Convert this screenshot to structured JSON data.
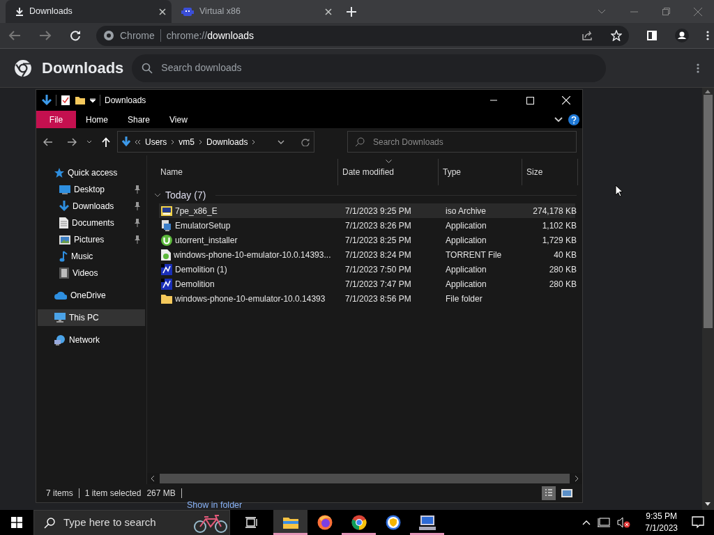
{
  "browser": {
    "tabs": [
      {
        "title": "Downloads",
        "kind": "downloads",
        "selected": true
      },
      {
        "title": "Virtual x86",
        "kind": "app",
        "selected": false
      }
    ],
    "address": {
      "origin_label": "Chrome",
      "url_prefix": "chrome://",
      "url_path": "downloads"
    }
  },
  "downloads_page": {
    "title": "Downloads",
    "search": {
      "placeholder": "Search downloads"
    },
    "show_in_folder": "Show in folder"
  },
  "explorer": {
    "title": "Downloads",
    "ribbon_tabs": [
      {
        "label": "File",
        "kind": "menu"
      },
      {
        "label": "Home",
        "kind": "tab"
      },
      {
        "label": "Share",
        "kind": "tab"
      },
      {
        "label": "View",
        "kind": "tab"
      }
    ],
    "breadcrumb": [
      "Users",
      "vm5",
      "Downloads"
    ],
    "search": {
      "placeholder": "Search Downloads"
    },
    "sidebar": [
      {
        "label": "Quick access",
        "kind": "star",
        "selected": false,
        "children": [
          {
            "label": "Desktop",
            "kind": "desktop",
            "pinned": true,
            "selected": false
          },
          {
            "label": "Downloads",
            "kind": "download",
            "pinned": true,
            "selected": false
          },
          {
            "label": "Documents",
            "kind": "document",
            "pinned": true,
            "selected": false
          },
          {
            "label": "Pictures",
            "kind": "pictures",
            "pinned": true,
            "selected": false
          },
          {
            "label": "Music",
            "kind": "music",
            "pinned": false,
            "selected": false
          },
          {
            "label": "Videos",
            "kind": "videos",
            "pinned": false,
            "selected": false
          }
        ]
      },
      {
        "label": "OneDrive",
        "kind": "cloud",
        "selected": false
      },
      {
        "label": "This PC",
        "kind": "pc",
        "selected": true
      },
      {
        "label": "Network",
        "kind": "network",
        "selected": false
      }
    ],
    "columns": [
      {
        "label": "Name",
        "sorted": false
      },
      {
        "label": "Date modified",
        "sorted": true
      },
      {
        "label": "Type",
        "sorted": false
      },
      {
        "label": "Size",
        "sorted": false
      }
    ],
    "group": {
      "label": "Today (7)",
      "expanded": true
    },
    "rows": [
      {
        "name": "7pe_x86_E",
        "date": "7/1/2023 9:25 PM",
        "type": "iso Archive",
        "size": "274,178 KB",
        "kind": "iso",
        "selected": true
      },
      {
        "name": "EmulatorSetup",
        "date": "7/1/2023 8:26 PM",
        "type": "Application",
        "size": "1,102 KB",
        "kind": "setup",
        "selected": false
      },
      {
        "name": "utorrent_installer",
        "date": "7/1/2023 8:25 PM",
        "type": "Application",
        "size": "1,729 KB",
        "kind": "utorrent",
        "selected": false
      },
      {
        "name": "windows-phone-10-emulator-10.0.14393...",
        "date": "7/1/2023 8:24 PM",
        "type": "TORRENT File",
        "size": "40 KB",
        "kind": "torrent",
        "selected": false
      },
      {
        "name": "Demolition (1)",
        "date": "7/1/2023 7:50 PM",
        "type": "Application",
        "size": "280 KB",
        "kind": "app",
        "selected": false
      },
      {
        "name": "Demolition",
        "date": "7/1/2023 7:47 PM",
        "type": "Application",
        "size": "280 KB",
        "kind": "app",
        "selected": false
      },
      {
        "name": "windows-phone-10-emulator-10.0.14393",
        "date": "7/1/2023 8:56 PM",
        "type": "File folder",
        "size": "",
        "kind": "folder",
        "selected": false
      }
    ],
    "status_bar": {
      "count": "7 items",
      "selection": "1 item selected",
      "selection_size": "267 MB"
    }
  },
  "taskbar": {
    "search": {
      "placeholder": "Type here to search"
    },
    "apps": [
      {
        "kind": "explorer",
        "running": true,
        "selected": true
      },
      {
        "kind": "firefox",
        "running": false,
        "selected": false
      },
      {
        "kind": "chrome",
        "running": true,
        "selected": false
      },
      {
        "kind": "shield",
        "running": false,
        "selected": false
      },
      {
        "kind": "computer",
        "running": true,
        "selected": false
      }
    ],
    "time": "9:35 PM",
    "date": "7/1/2023"
  }
}
